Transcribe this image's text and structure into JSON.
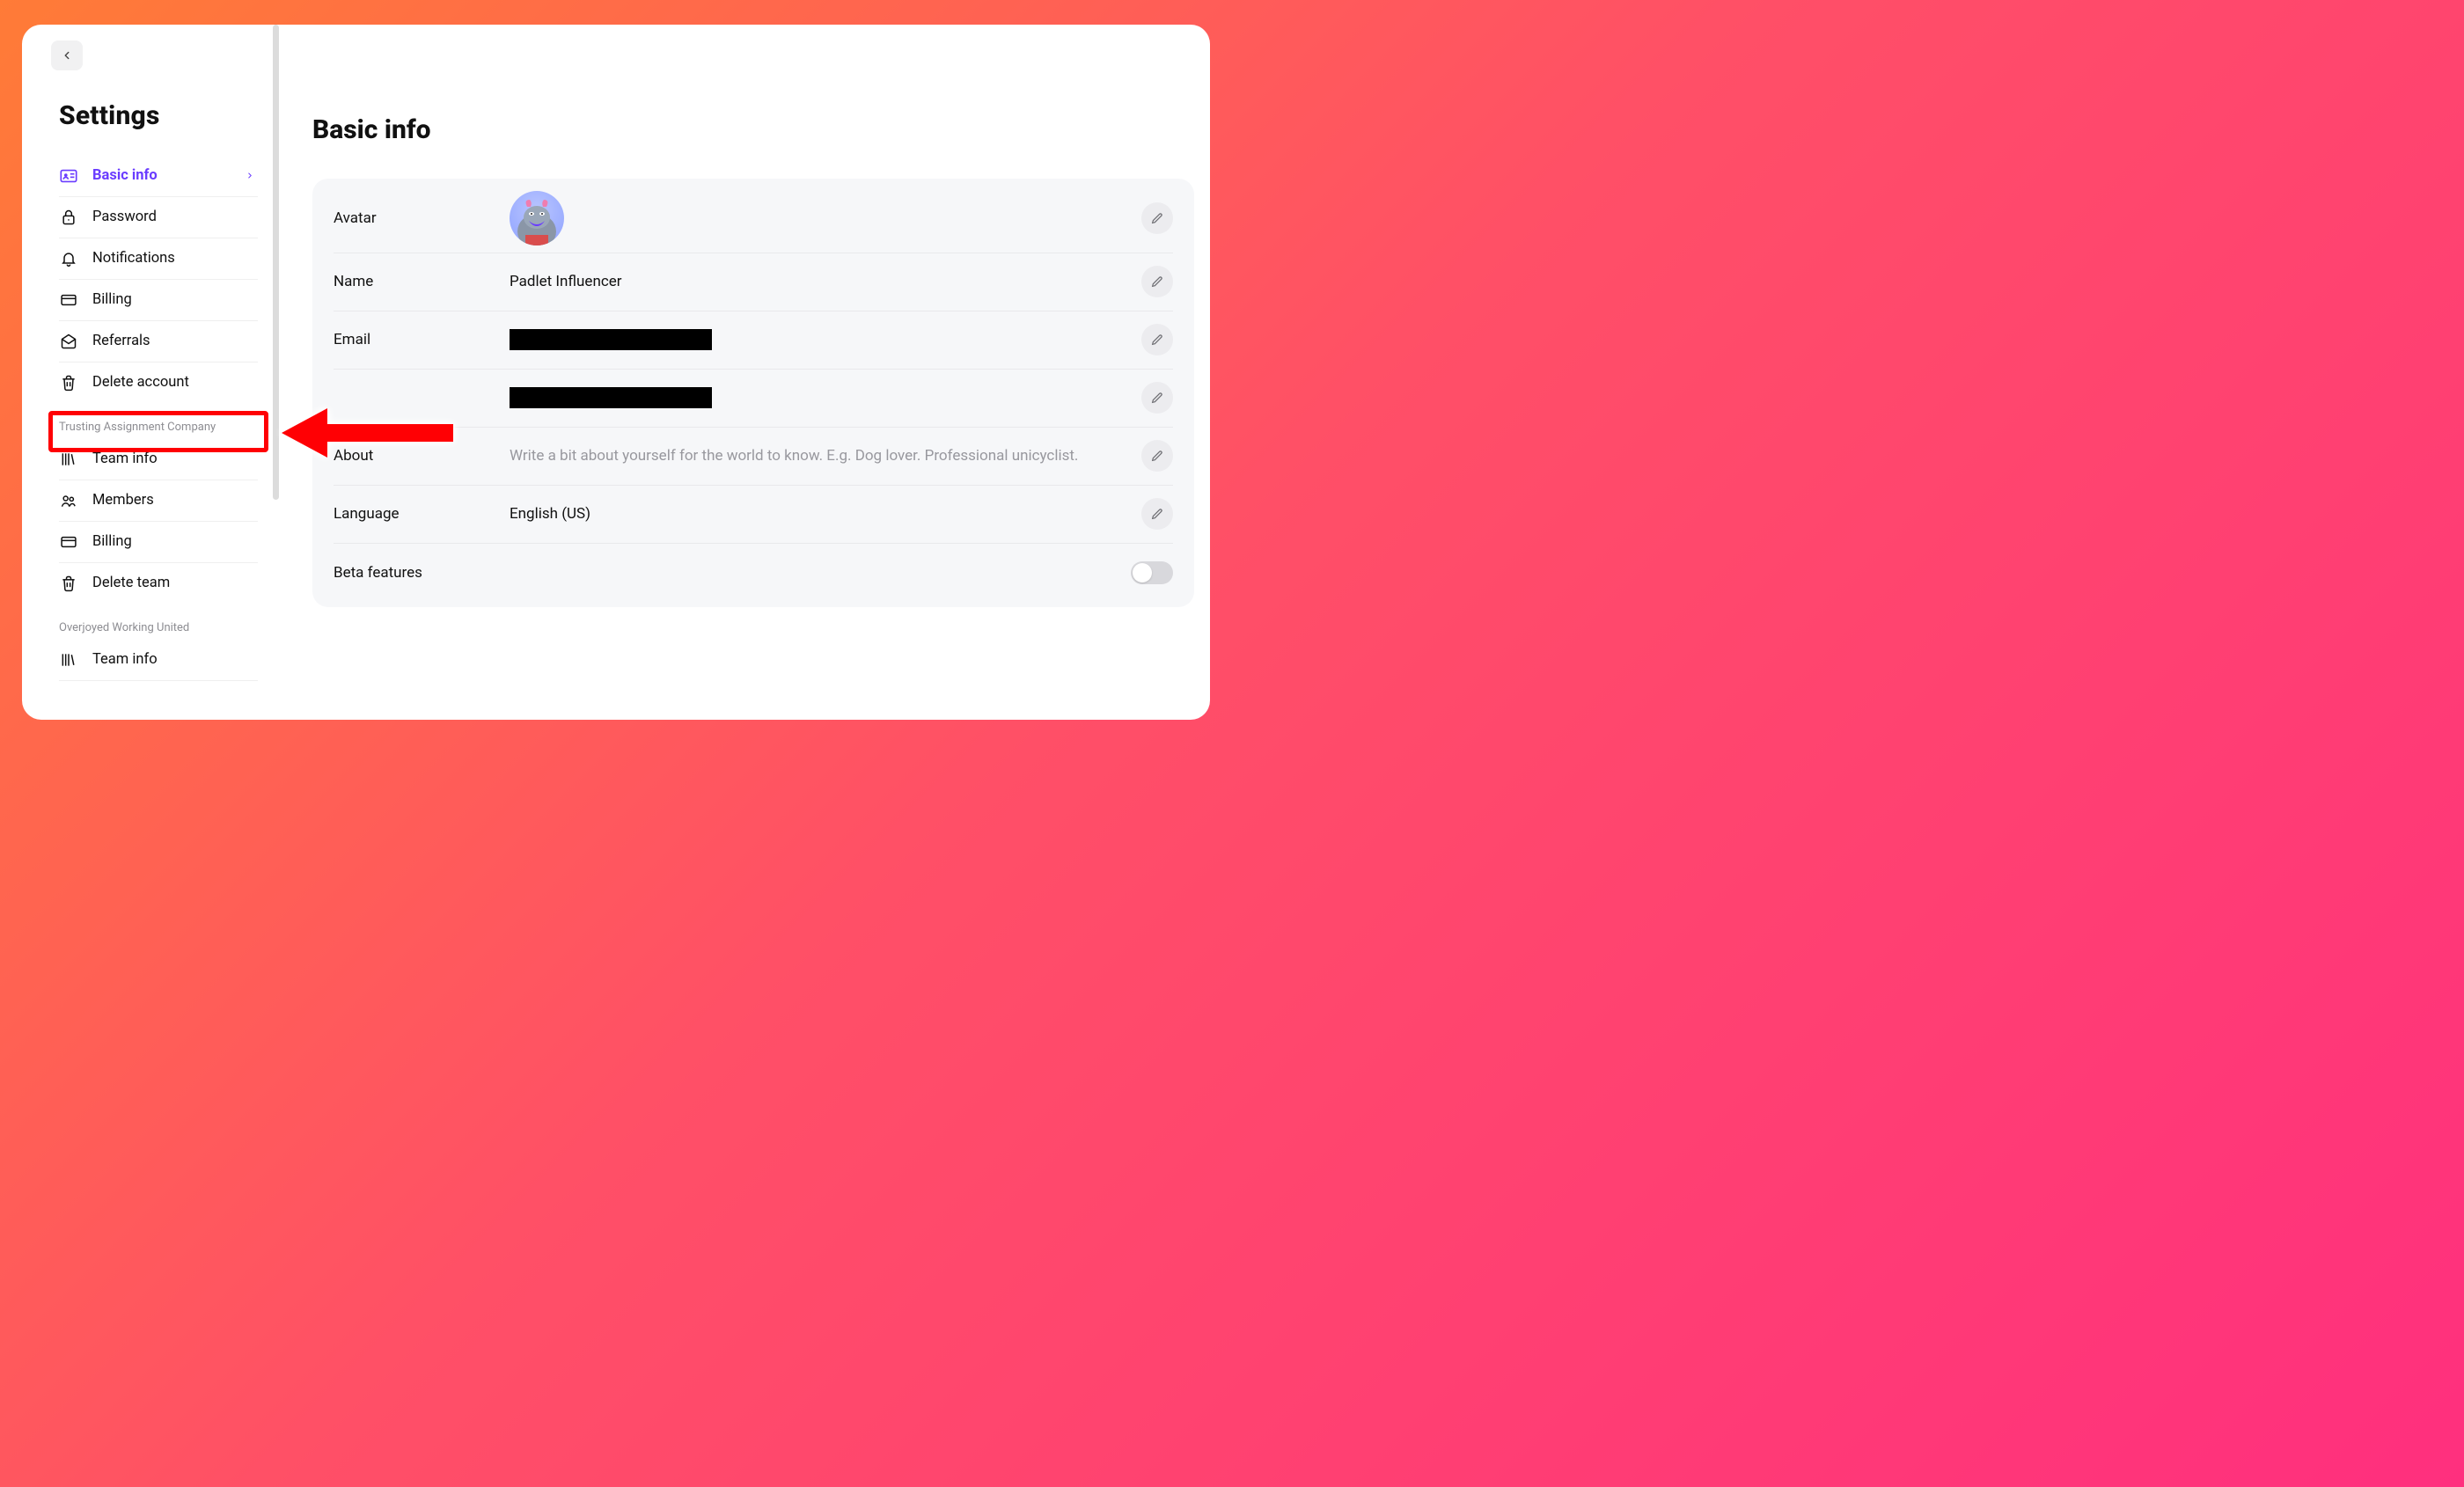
{
  "sidebar": {
    "title": "Settings",
    "items": [
      {
        "label": "Basic info",
        "icon": "id-card-icon",
        "active": true
      },
      {
        "label": "Password",
        "icon": "lock-icon"
      },
      {
        "label": "Notifications",
        "icon": "bell-icon"
      },
      {
        "label": "Billing",
        "icon": "credit-card-icon"
      },
      {
        "label": "Referrals",
        "icon": "envelope-open-icon"
      },
      {
        "label": "Delete account",
        "icon": "trash-icon"
      }
    ],
    "groups": [
      {
        "label": "Trusting Assignment Company",
        "items": [
          {
            "label": "Team info",
            "icon": "books-icon"
          },
          {
            "label": "Members",
            "icon": "people-icon"
          },
          {
            "label": "Billing",
            "icon": "credit-card-icon"
          },
          {
            "label": "Delete team",
            "icon": "trash-icon"
          }
        ]
      },
      {
        "label": "Overjoyed Working United",
        "items": [
          {
            "label": "Team info",
            "icon": "books-icon"
          }
        ]
      }
    ]
  },
  "main": {
    "title": "Basic info",
    "rows": {
      "avatar": {
        "label": "Avatar"
      },
      "name": {
        "label": "Name",
        "value": "Padlet Influencer"
      },
      "email": {
        "label": "Email",
        "redacted_width": 230
      },
      "username": {
        "label": "",
        "redacted_width": 230
      },
      "about": {
        "label": "About",
        "placeholder": "Write a bit about yourself for the world to know. E.g. Dog lover. Professional unicyclist."
      },
      "language": {
        "label": "Language",
        "value": "English (US)"
      },
      "beta": {
        "label": "Beta features",
        "enabled": false
      }
    }
  },
  "annotation": {
    "highlighted_item": "Delete account"
  }
}
